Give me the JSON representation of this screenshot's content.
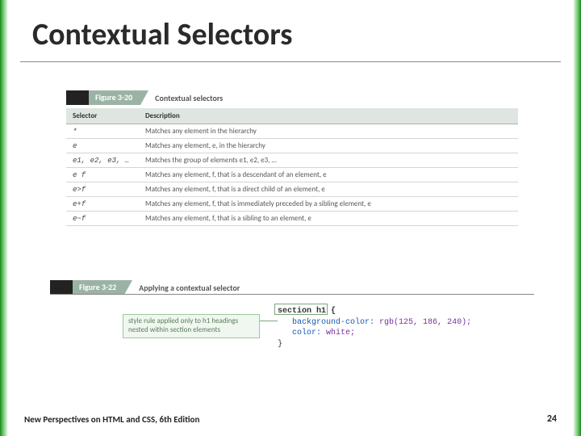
{
  "title": "Contextual Selectors",
  "figure1": {
    "label": "Figure 3-20",
    "caption": "Contextual selectors",
    "headers": {
      "col1": "Selector",
      "col2": "Description"
    },
    "rows": [
      {
        "sel": "*",
        "desc": "Matches any element in the hierarchy"
      },
      {
        "sel": "e",
        "desc": "Matches any element, e, in the hierarchy"
      },
      {
        "sel": "e1, e2, e3, …",
        "desc": "Matches the group of elements e1, e2, e3, …"
      },
      {
        "sel": "e f",
        "desc": "Matches any element, f, that is a descendant of an element, e"
      },
      {
        "sel": "e>f",
        "desc": "Matches any element, f, that is a direct child of an element, e"
      },
      {
        "sel": "e+f",
        "desc": "Matches any element, f, that is immediately preceded by a sibling element, e"
      },
      {
        "sel": "e~f",
        "desc": "Matches any element, f, that is a sibling to an element, e"
      }
    ]
  },
  "figure2": {
    "label": "Figure 3-22",
    "caption": "Applying a contextual selector",
    "callout": "style rule applied only to h1 headings nested within section elements",
    "code": {
      "line1": "section h1 {",
      "line2_prop": "background-color:",
      "line2_val": " rgb(125, 186, 240);",
      "line3_prop": "color:",
      "line3_val": " white;",
      "line4": "}"
    }
  },
  "footer": {
    "left": "New Perspectives on HTML and CSS, 6th Edition",
    "page": "24"
  }
}
